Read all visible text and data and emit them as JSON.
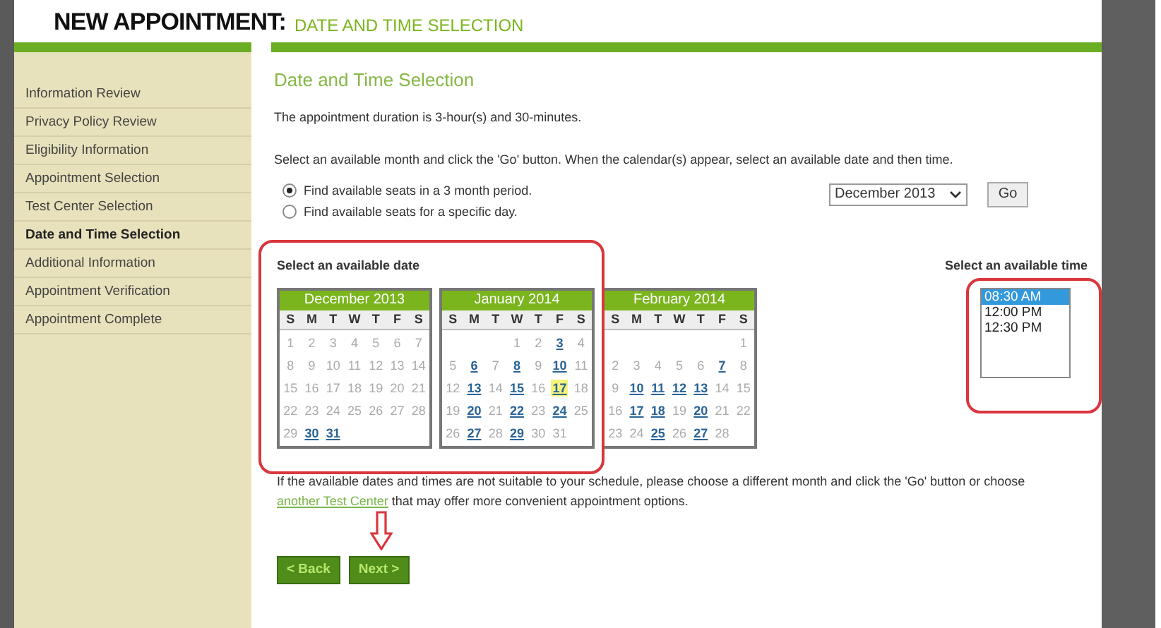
{
  "header": {
    "title": "NEW APPOINTMENT:",
    "subtitle": "DATE AND TIME SELECTION"
  },
  "sidebar": {
    "items": [
      {
        "label": "Information Review",
        "selected": false
      },
      {
        "label": "Privacy Policy Review",
        "selected": false
      },
      {
        "label": "Eligibility Information",
        "selected": false
      },
      {
        "label": "Appointment Selection",
        "selected": false
      },
      {
        "label": "Test Center Selection",
        "selected": false
      },
      {
        "label": "Date and Time Selection",
        "selected": true
      },
      {
        "label": "Additional Information",
        "selected": false
      },
      {
        "label": "Appointment Verification",
        "selected": false
      },
      {
        "label": "Appointment Complete",
        "selected": false
      }
    ]
  },
  "main": {
    "title": "Date and Time Selection",
    "duration_text": "The appointment duration is 3-hour(s) and 30-minutes.",
    "instructions": "Select an available month and click the 'Go' button. When the calendar(s) appear, select an available date and then time.",
    "search_options": [
      {
        "label": "Find available seats in a 3 month period.",
        "selected": true
      },
      {
        "label": "Find available seats for a specific day.",
        "selected": false
      }
    ],
    "month_select": {
      "value": "December 2013"
    },
    "go_button": "Go",
    "date_label": "Select an available date",
    "time_label": "Select an available time",
    "calendars": [
      {
        "month": "December 2013",
        "weekdays": [
          "S",
          "M",
          "T",
          "W",
          "T",
          "F",
          "S"
        ],
        "days": [
          {
            "kind": "day",
            "d": "1",
            "available": false,
            "selected": false
          },
          {
            "kind": "day",
            "d": "2",
            "available": false,
            "selected": false
          },
          {
            "kind": "day",
            "d": "3",
            "available": false,
            "selected": false
          },
          {
            "kind": "day",
            "d": "4",
            "available": false,
            "selected": false
          },
          {
            "kind": "day",
            "d": "5",
            "available": false,
            "selected": false
          },
          {
            "kind": "day",
            "d": "6",
            "available": false,
            "selected": false
          },
          {
            "kind": "day",
            "d": "7",
            "available": false,
            "selected": false
          },
          {
            "kind": "day",
            "d": "8",
            "available": false,
            "selected": false
          },
          {
            "kind": "day",
            "d": "9",
            "available": false,
            "selected": false
          },
          {
            "kind": "day",
            "d": "10",
            "available": false,
            "selected": false
          },
          {
            "kind": "day",
            "d": "11",
            "available": false,
            "selected": false
          },
          {
            "kind": "day",
            "d": "12",
            "available": false,
            "selected": false
          },
          {
            "kind": "day",
            "d": "13",
            "available": false,
            "selected": false
          },
          {
            "kind": "day",
            "d": "14",
            "available": false,
            "selected": false
          },
          {
            "kind": "day",
            "d": "15",
            "available": false,
            "selected": false
          },
          {
            "kind": "day",
            "d": "16",
            "available": false,
            "selected": false
          },
          {
            "kind": "day",
            "d": "17",
            "available": false,
            "selected": false
          },
          {
            "kind": "day",
            "d": "18",
            "available": false,
            "selected": false
          },
          {
            "kind": "day",
            "d": "19",
            "available": false,
            "selected": false
          },
          {
            "kind": "day",
            "d": "20",
            "available": false,
            "selected": false
          },
          {
            "kind": "day",
            "d": "21",
            "available": false,
            "selected": false
          },
          {
            "kind": "day",
            "d": "22",
            "available": false,
            "selected": false
          },
          {
            "kind": "day",
            "d": "23",
            "available": false,
            "selected": false
          },
          {
            "kind": "day",
            "d": "24",
            "available": false,
            "selected": false
          },
          {
            "kind": "day",
            "d": "25",
            "available": false,
            "selected": false
          },
          {
            "kind": "day",
            "d": "26",
            "available": false,
            "selected": false
          },
          {
            "kind": "day",
            "d": "27",
            "available": false,
            "selected": false
          },
          {
            "kind": "day",
            "d": "28",
            "available": false,
            "selected": false
          },
          {
            "kind": "day",
            "d": "29",
            "available": false,
            "selected": false
          },
          {
            "kind": "day",
            "d": "30",
            "available": true,
            "selected": false
          },
          {
            "kind": "day",
            "d": "31",
            "available": true,
            "selected": false
          }
        ]
      },
      {
        "month": "January 2014",
        "weekdays": [
          "S",
          "M",
          "T",
          "W",
          "T",
          "F",
          "S"
        ],
        "days": [
          {
            "kind": "blank"
          },
          {
            "kind": "blank"
          },
          {
            "kind": "blank"
          },
          {
            "kind": "day",
            "d": "1",
            "available": false,
            "selected": false
          },
          {
            "kind": "day",
            "d": "2",
            "available": false,
            "selected": false
          },
          {
            "kind": "day",
            "d": "3",
            "available": true,
            "selected": false
          },
          {
            "kind": "day",
            "d": "4",
            "available": false,
            "selected": false
          },
          {
            "kind": "day",
            "d": "5",
            "available": false,
            "selected": false
          },
          {
            "kind": "day",
            "d": "6",
            "available": true,
            "selected": false
          },
          {
            "kind": "day",
            "d": "7",
            "available": false,
            "selected": false
          },
          {
            "kind": "day",
            "d": "8",
            "available": true,
            "selected": false
          },
          {
            "kind": "day",
            "d": "9",
            "available": false,
            "selected": false
          },
          {
            "kind": "day",
            "d": "10",
            "available": true,
            "selected": false
          },
          {
            "kind": "day",
            "d": "11",
            "available": false,
            "selected": false
          },
          {
            "kind": "day",
            "d": "12",
            "available": false,
            "selected": false
          },
          {
            "kind": "day",
            "d": "13",
            "available": true,
            "selected": false
          },
          {
            "kind": "day",
            "d": "14",
            "available": false,
            "selected": false
          },
          {
            "kind": "day",
            "d": "15",
            "available": true,
            "selected": false
          },
          {
            "kind": "day",
            "d": "16",
            "available": false,
            "selected": false
          },
          {
            "kind": "day",
            "d": "17",
            "available": true,
            "selected": true
          },
          {
            "kind": "day",
            "d": "18",
            "available": false,
            "selected": false
          },
          {
            "kind": "day",
            "d": "19",
            "available": false,
            "selected": false
          },
          {
            "kind": "day",
            "d": "20",
            "available": true,
            "selected": false
          },
          {
            "kind": "day",
            "d": "21",
            "available": false,
            "selected": false
          },
          {
            "kind": "day",
            "d": "22",
            "available": true,
            "selected": false
          },
          {
            "kind": "day",
            "d": "23",
            "available": false,
            "selected": false
          },
          {
            "kind": "day",
            "d": "24",
            "available": true,
            "selected": false
          },
          {
            "kind": "day",
            "d": "25",
            "available": false,
            "selected": false
          },
          {
            "kind": "day",
            "d": "26",
            "available": false,
            "selected": false
          },
          {
            "kind": "day",
            "d": "27",
            "available": true,
            "selected": false
          },
          {
            "kind": "day",
            "d": "28",
            "available": false,
            "selected": false
          },
          {
            "kind": "day",
            "d": "29",
            "available": true,
            "selected": false
          },
          {
            "kind": "day",
            "d": "30",
            "available": false,
            "selected": false
          },
          {
            "kind": "day",
            "d": "31",
            "available": false,
            "selected": false
          }
        ]
      },
      {
        "month": "February 2014",
        "weekdays": [
          "S",
          "M",
          "T",
          "W",
          "T",
          "F",
          "S"
        ],
        "days": [
          {
            "kind": "blank"
          },
          {
            "kind": "blank"
          },
          {
            "kind": "blank"
          },
          {
            "kind": "blank"
          },
          {
            "kind": "blank"
          },
          {
            "kind": "blank"
          },
          {
            "kind": "day",
            "d": "1",
            "available": false,
            "selected": false
          },
          {
            "kind": "day",
            "d": "2",
            "available": false,
            "selected": false
          },
          {
            "kind": "day",
            "d": "3",
            "available": false,
            "selected": false
          },
          {
            "kind": "day",
            "d": "4",
            "available": false,
            "selected": false
          },
          {
            "kind": "day",
            "d": "5",
            "available": false,
            "selected": false
          },
          {
            "kind": "day",
            "d": "6",
            "available": false,
            "selected": false
          },
          {
            "kind": "day",
            "d": "7",
            "available": true,
            "selected": false
          },
          {
            "kind": "day",
            "d": "8",
            "available": false,
            "selected": false
          },
          {
            "kind": "day",
            "d": "9",
            "available": false,
            "selected": false
          },
          {
            "kind": "day",
            "d": "10",
            "available": true,
            "selected": false
          },
          {
            "kind": "day",
            "d": "11",
            "available": true,
            "selected": false
          },
          {
            "kind": "day",
            "d": "12",
            "available": true,
            "selected": false
          },
          {
            "kind": "day",
            "d": "13",
            "available": true,
            "selected": false
          },
          {
            "kind": "day",
            "d": "14",
            "available": false,
            "selected": false
          },
          {
            "kind": "day",
            "d": "15",
            "available": false,
            "selected": false
          },
          {
            "kind": "day",
            "d": "16",
            "available": false,
            "selected": false
          },
          {
            "kind": "day",
            "d": "17",
            "available": true,
            "selected": false
          },
          {
            "kind": "day",
            "d": "18",
            "available": true,
            "selected": false
          },
          {
            "kind": "day",
            "d": "19",
            "available": false,
            "selected": false
          },
          {
            "kind": "day",
            "d": "20",
            "available": true,
            "selected": false
          },
          {
            "kind": "day",
            "d": "21",
            "available": false,
            "selected": false
          },
          {
            "kind": "day",
            "d": "22",
            "available": false,
            "selected": false
          },
          {
            "kind": "day",
            "d": "23",
            "available": false,
            "selected": false
          },
          {
            "kind": "day",
            "d": "24",
            "available": false,
            "selected": false
          },
          {
            "kind": "day",
            "d": "25",
            "available": true,
            "selected": false
          },
          {
            "kind": "day",
            "d": "26",
            "available": false,
            "selected": false
          },
          {
            "kind": "day",
            "d": "27",
            "available": true,
            "selected": false
          },
          {
            "kind": "day",
            "d": "28",
            "available": false,
            "selected": false
          }
        ]
      }
    ],
    "times": [
      {
        "label": "08:30 AM",
        "selected": true
      },
      {
        "label": "12:00 PM",
        "selected": false
      },
      {
        "label": "12:30 PM",
        "selected": false
      }
    ],
    "note_before": "If the available dates and times are not suitable to your schedule, please choose a different month and click the 'Go' button or choose",
    "note_link": "another Test Center",
    "note_after": "that may offer more convenient appointment options.",
    "buttons": [
      "< Back",
      "Next >"
    ]
  }
}
